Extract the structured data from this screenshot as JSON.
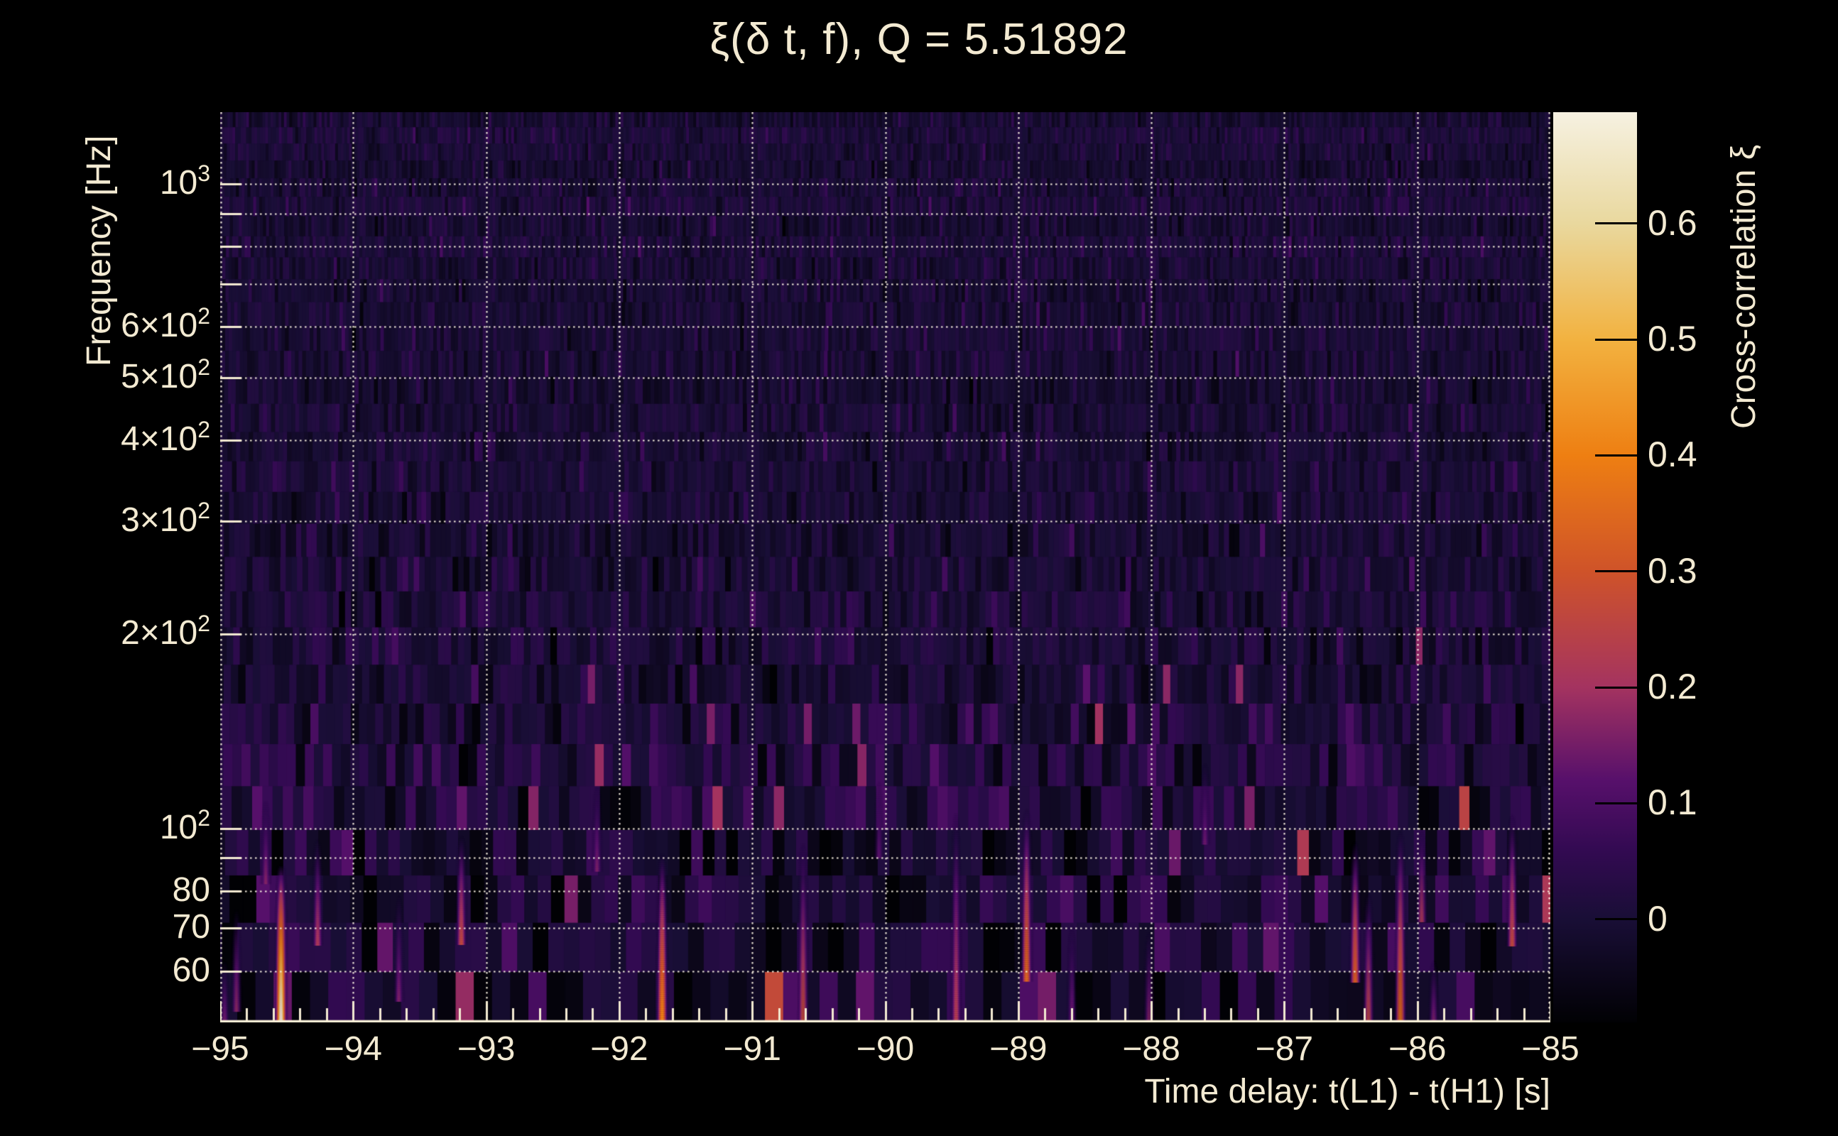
{
  "title": {
    "text": "ξ(δ t, f), Q = 5.51892"
  },
  "colors": {
    "background": "#000000",
    "text": "#f3ead2",
    "grid": "#f8f1de",
    "axis_line": "#f3ead2",
    "colorbar_tick": "#000000"
  },
  "x_axis": {
    "title": "Time delay: t(L1) - t(H1) [s]",
    "min": -95,
    "max": -85,
    "minor_tick_interval": 0.2,
    "ticks": [
      {
        "label": "−95",
        "t": -95
      },
      {
        "label": "−94",
        "t": -94
      },
      {
        "label": "−93",
        "t": -93
      },
      {
        "label": "−92",
        "t": -92
      },
      {
        "label": "−91",
        "t": -91
      },
      {
        "label": "−90",
        "t": -90
      },
      {
        "label": "−89",
        "t": -89
      },
      {
        "label": "−88",
        "t": -88
      },
      {
        "label": "−87",
        "t": -87
      },
      {
        "label": "−86",
        "t": -86
      },
      {
        "label": "−85",
        "t": -85
      }
    ]
  },
  "y_axis": {
    "title": "Frequency [Hz]",
    "scale": "log",
    "min": 50,
    "max": 1292,
    "ticks": [
      {
        "base": "10",
        "sup": "3",
        "f": 1000
      },
      {
        "base": "6×10",
        "sup": "2",
        "f": 600
      },
      {
        "base": "5×10",
        "sup": "2",
        "f": 500
      },
      {
        "base": "4×10",
        "sup": "2",
        "f": 400
      },
      {
        "base": "3×10",
        "sup": "2",
        "f": 300
      },
      {
        "base": "2×10",
        "sup": "2",
        "f": 200
      },
      {
        "base": "10",
        "sup": "2",
        "f": 100
      },
      {
        "base": "80",
        "sup": "",
        "f": 80
      },
      {
        "base": "70",
        "sup": "",
        "f": 70
      },
      {
        "base": "60",
        "sup": "",
        "f": 60
      }
    ],
    "grid_frequencies": [
      1000,
      900,
      800,
      700,
      600,
      500,
      400,
      300,
      200,
      100,
      90,
      80,
      70,
      60
    ]
  },
  "colorbar": {
    "title": "Cross-correlation ξ",
    "min": -0.089,
    "max": 0.696,
    "ticks": [
      {
        "label": "0.6",
        "v": 0.6
      },
      {
        "label": "0.5",
        "v": 0.5
      },
      {
        "label": "0.4",
        "v": 0.4
      },
      {
        "label": "0.3",
        "v": 0.3
      },
      {
        "label": "0.2",
        "v": 0.2
      },
      {
        "label": "0.1",
        "v": 0.1
      },
      {
        "label": "0",
        "v": 0.0
      }
    ],
    "palette_stops": [
      {
        "v": -0.089,
        "c": "#010104"
      },
      {
        "v": 0.0,
        "c": "#190e36"
      },
      {
        "v": 0.06,
        "c": "#330a52"
      },
      {
        "v": 0.12,
        "c": "#57106b"
      },
      {
        "v": 0.2,
        "c": "#a43360"
      },
      {
        "v": 0.3,
        "c": "#cf5329"
      },
      {
        "v": 0.4,
        "c": "#ee7f12"
      },
      {
        "v": 0.5,
        "c": "#f2b240"
      },
      {
        "v": 0.6,
        "c": "#e9d89e"
      },
      {
        "v": 0.696,
        "c": "#f6f1e1"
      }
    ]
  },
  "chart_data": {
    "type": "heatmap",
    "title": "ξ(δ t, f), Q = 5.51892",
    "xlabel": "Time delay: t(L1) - t(H1) [s]",
    "ylabel": "Frequency [Hz]",
    "zlabel": "Cross-correlation ξ",
    "x_range": [
      -95,
      -85
    ],
    "y_range_hz": [
      50,
      1292
    ],
    "y_scale": "log",
    "z_range": [
      -0.089,
      0.696
    ],
    "background_noise": {
      "seed": 7,
      "base_level": 0.0,
      "sigma_high_f": 0.018,
      "sigma_low_f": 0.055,
      "low_f_boost_below_hz": 150
    },
    "hotspots": [
      {
        "t": -94.97,
        "f_lo": 50,
        "f_hi": 63,
        "peak": 0.15
      },
      {
        "t": -94.88,
        "f_lo": 52,
        "f_hi": 76,
        "peak": 0.18
      },
      {
        "t": -94.66,
        "f_lo": 82,
        "f_hi": 112,
        "peak": 0.17
      },
      {
        "t": -94.545,
        "f_lo": 50,
        "f_hi": 88,
        "peak": 0.7
      },
      {
        "t": -94.27,
        "f_lo": 66,
        "f_hi": 97,
        "peak": 0.22
      },
      {
        "t": -93.66,
        "f_lo": 54,
        "f_hi": 80,
        "peak": 0.16
      },
      {
        "t": -93.19,
        "f_lo": 66,
        "f_hi": 98,
        "peak": 0.27
      },
      {
        "t": -92.17,
        "f_lo": 86,
        "f_hi": 118,
        "peak": 0.16
      },
      {
        "t": -91.68,
        "f_lo": 50,
        "f_hi": 92,
        "peak": 0.42
      },
      {
        "t": -90.62,
        "f_lo": 50,
        "f_hi": 96,
        "peak": 0.28
      },
      {
        "t": -90.05,
        "f_lo": 90,
        "f_hi": 120,
        "peak": 0.13
      },
      {
        "t": -89.47,
        "f_lo": 50,
        "f_hi": 108,
        "peak": 0.24
      },
      {
        "t": -88.94,
        "f_lo": 58,
        "f_hi": 108,
        "peak": 0.36
      },
      {
        "t": -88.6,
        "f_lo": 50,
        "f_hi": 72,
        "peak": 0.15
      },
      {
        "t": -88.02,
        "f_lo": 50,
        "f_hi": 70,
        "peak": 0.17
      },
      {
        "t": -87.6,
        "f_lo": 95,
        "f_hi": 128,
        "peak": 0.14
      },
      {
        "t": -86.47,
        "f_lo": 58,
        "f_hi": 96,
        "peak": 0.33
      },
      {
        "t": -86.37,
        "f_lo": 50,
        "f_hi": 80,
        "peak": 0.26
      },
      {
        "t": -86.13,
        "f_lo": 50,
        "f_hi": 100,
        "peak": 0.37
      },
      {
        "t": -85.97,
        "f_lo": 72,
        "f_hi": 100,
        "peak": 0.22
      },
      {
        "t": -85.88,
        "f_lo": 50,
        "f_hi": 63,
        "peak": 0.16
      },
      {
        "t": -85.29,
        "f_lo": 66,
        "f_hi": 106,
        "peak": 0.27
      }
    ]
  }
}
